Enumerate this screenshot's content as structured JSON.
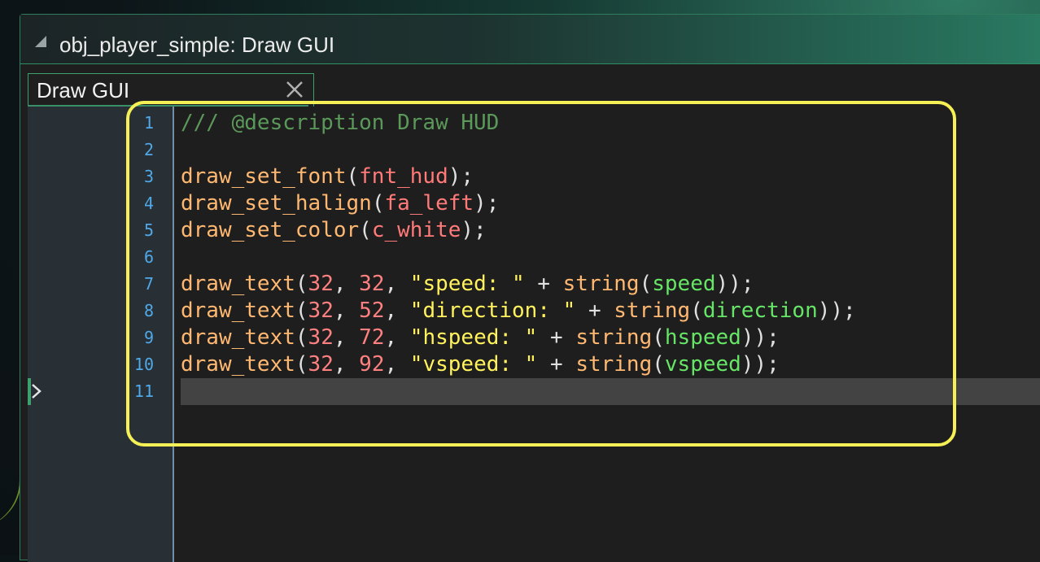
{
  "window": {
    "title": "obj_player_simple: Draw GUI"
  },
  "tab": {
    "label": "Draw GUI",
    "close_icon": "close-icon"
  },
  "colors": {
    "accent": "#3ea06f",
    "highlight": "#f5f055",
    "line_numbers": "#4fa9e8",
    "function": "#ffb871",
    "resource": "#ff7a78",
    "number": "#ff8080",
    "string": "#fff25c",
    "variable": "#66e566",
    "comment": "#5b995b"
  },
  "editor": {
    "line_numbers": [
      "1",
      "2",
      "3",
      "4",
      "5",
      "6",
      "7",
      "8",
      "9",
      "10",
      "11"
    ],
    "lines": [
      [
        {
          "t": "/// @description Draw HUD",
          "c": "cmt"
        }
      ],
      [],
      [
        {
          "t": "draw_set_font",
          "c": "fn"
        },
        {
          "t": "(",
          "c": "punc"
        },
        {
          "t": "fnt_hud",
          "c": "res"
        },
        {
          "t": ");",
          "c": "punc"
        }
      ],
      [
        {
          "t": "draw_set_halign",
          "c": "fn"
        },
        {
          "t": "(",
          "c": "punc"
        },
        {
          "t": "fa_left",
          "c": "res"
        },
        {
          "t": ");",
          "c": "punc"
        }
      ],
      [
        {
          "t": "draw_set_color",
          "c": "fn"
        },
        {
          "t": "(",
          "c": "punc"
        },
        {
          "t": "c_white",
          "c": "res"
        },
        {
          "t": ");",
          "c": "punc"
        }
      ],
      [],
      [
        {
          "t": "draw_text",
          "c": "fn"
        },
        {
          "t": "(",
          "c": "punc"
        },
        {
          "t": "32",
          "c": "num"
        },
        {
          "t": ", ",
          "c": "punc"
        },
        {
          "t": "32",
          "c": "num"
        },
        {
          "t": ", ",
          "c": "punc"
        },
        {
          "t": "\"speed: \"",
          "c": "str"
        },
        {
          "t": " + ",
          "c": "punc"
        },
        {
          "t": "string",
          "c": "fn"
        },
        {
          "t": "(",
          "c": "punc"
        },
        {
          "t": "speed",
          "c": "var"
        },
        {
          "t": "));",
          "c": "punc"
        }
      ],
      [
        {
          "t": "draw_text",
          "c": "fn"
        },
        {
          "t": "(",
          "c": "punc"
        },
        {
          "t": "32",
          "c": "num"
        },
        {
          "t": ", ",
          "c": "punc"
        },
        {
          "t": "52",
          "c": "num"
        },
        {
          "t": ", ",
          "c": "punc"
        },
        {
          "t": "\"direction: \"",
          "c": "str"
        },
        {
          "t": " + ",
          "c": "punc"
        },
        {
          "t": "string",
          "c": "fn"
        },
        {
          "t": "(",
          "c": "punc"
        },
        {
          "t": "direction",
          "c": "var"
        },
        {
          "t": "));",
          "c": "punc"
        }
      ],
      [
        {
          "t": "draw_text",
          "c": "fn"
        },
        {
          "t": "(",
          "c": "punc"
        },
        {
          "t": "32",
          "c": "num"
        },
        {
          "t": ", ",
          "c": "punc"
        },
        {
          "t": "72",
          "c": "num"
        },
        {
          "t": ", ",
          "c": "punc"
        },
        {
          "t": "\"hspeed: \"",
          "c": "str"
        },
        {
          "t": " + ",
          "c": "punc"
        },
        {
          "t": "string",
          "c": "fn"
        },
        {
          "t": "(",
          "c": "punc"
        },
        {
          "t": "hspeed",
          "c": "var"
        },
        {
          "t": "));",
          "c": "punc"
        }
      ],
      [
        {
          "t": "draw_text",
          "c": "fn"
        },
        {
          "t": "(",
          "c": "punc"
        },
        {
          "t": "32",
          "c": "num"
        },
        {
          "t": ", ",
          "c": "punc"
        },
        {
          "t": "92",
          "c": "num"
        },
        {
          "t": ", ",
          "c": "punc"
        },
        {
          "t": "\"vspeed: \"",
          "c": "str"
        },
        {
          "t": " + ",
          "c": "punc"
        },
        {
          "t": "string",
          "c": "fn"
        },
        {
          "t": "(",
          "c": "punc"
        },
        {
          "t": "vspeed",
          "c": "var"
        },
        {
          "t": "));",
          "c": "punc"
        }
      ],
      []
    ]
  }
}
